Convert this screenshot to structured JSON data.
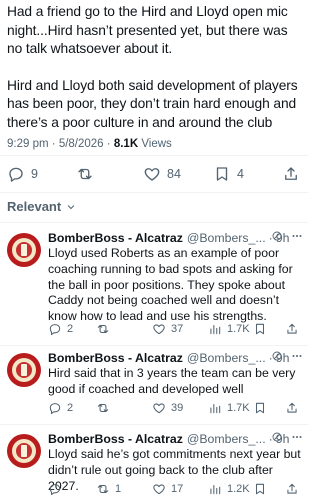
{
  "tweet": {
    "paragraph_1": "Had a friend go to the Hird and Lloyd open mic night...Hird hasn’t presented yet, but there was no talk whatsoever about it.",
    "paragraph_2": "Hird and Lloyd both said development of players has been poor, they don’t train hard enough and there’s a poor culture in and around the club",
    "time": "9:29 pm",
    "date": "5/8/2026",
    "views_count": "8.1K",
    "views_label": "Views",
    "actions": {
      "replies": "9",
      "likes": "84",
      "bookmarks": "4"
    }
  },
  "sort": {
    "label": "Relevant"
  },
  "replies": [
    {
      "name": "BomberBoss - Alcatraz",
      "handle": "@Bombers_...",
      "time": "9h",
      "text": "Lloyd used Roberts as an example of poor coaching running to bad spots and asking for the ball in poor positions. They spoke about Caddy not being coached well and doesn’t know how to lead and use his strengths.",
      "replies": "2",
      "reposts": "",
      "likes": "37",
      "views": "1.7K"
    },
    {
      "name": "BomberBoss - Alcatraz",
      "handle": "@Bombers_...",
      "time": "9h",
      "text": "Hird said that in 3 years the team can be very good if coached and developed well",
      "replies": "2",
      "reposts": "",
      "likes": "39",
      "views": "1.7K"
    },
    {
      "name": "BomberBoss - Alcatraz",
      "handle": "@Bombers_...",
      "time": "9h",
      "text": "Lloyd said he’s got commitments next year but didn’t rule out going back to the club after 2027.",
      "replies": "",
      "reposts": "1",
      "likes": "17",
      "views": "1.2K"
    }
  ],
  "colors": {
    "text": "#0f1419",
    "muted": "#536471",
    "avatar": "#b91c1c"
  }
}
